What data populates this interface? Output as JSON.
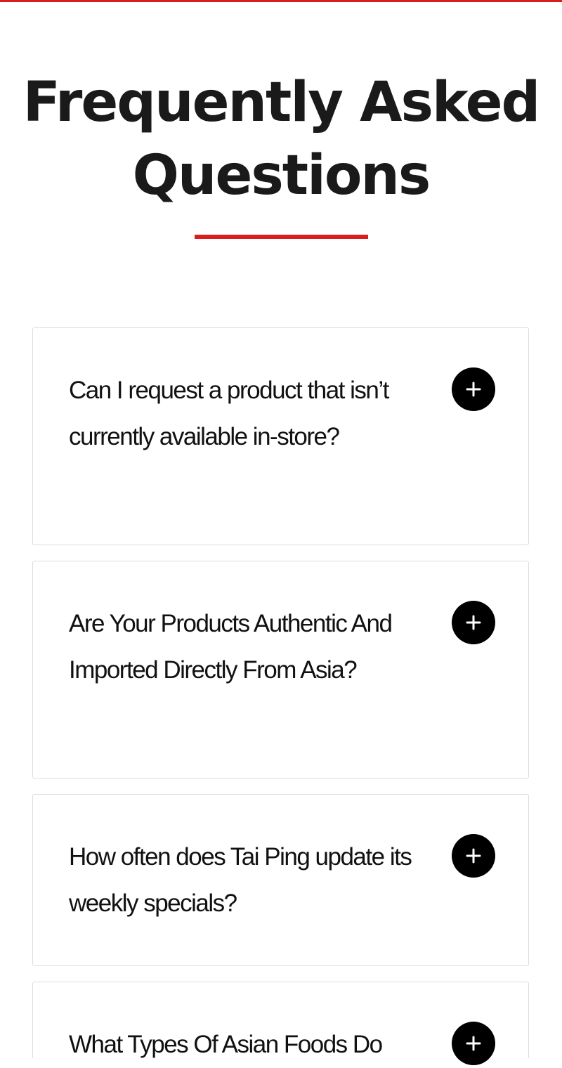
{
  "page": {
    "title": "Frequently Asked Questions",
    "accent_color": "#d81e1e"
  },
  "faq": {
    "toggle_icon": "plus-icon",
    "items": [
      {
        "question": "Can I request a product that isn’t currently available in-store?"
      },
      {
        "question": "Are Your Products Authentic And Imported Directly From Asia?"
      },
      {
        "question": "How often does Tai Ping update its weekly specials?"
      },
      {
        "question": "What Types Of Asian Foods Do"
      }
    ]
  }
}
